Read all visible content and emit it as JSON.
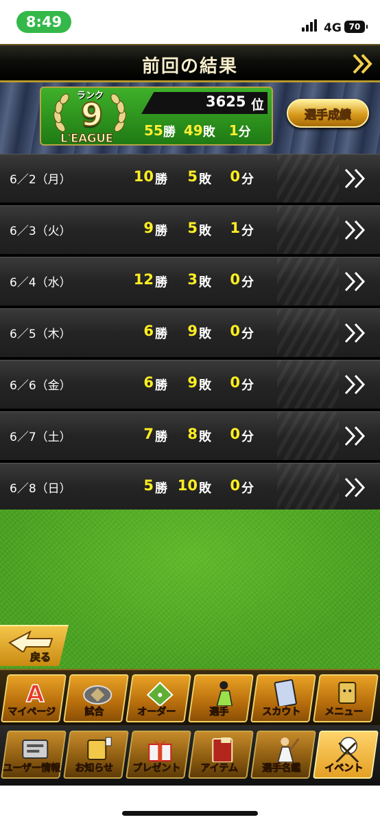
{
  "status_bar": {
    "time": "8:49",
    "network": "4G",
    "battery": "70"
  },
  "header": {
    "title": "前回の結果"
  },
  "summary": {
    "rank_word": "ランク",
    "rank_number": "9",
    "league_label": "L'EAGUE",
    "position": "3625",
    "position_unit": "位",
    "wins": "55",
    "wins_unit": "勝",
    "losses": "49",
    "losses_unit": "敗",
    "draws": "1",
    "draws_unit": "分",
    "stats_button": "選手成績"
  },
  "units": {
    "win": "勝",
    "loss": "敗",
    "draw": "分"
  },
  "rows": [
    {
      "date": "6／2（月）",
      "wins": "10",
      "losses": "5",
      "draws": "0"
    },
    {
      "date": "6／3（火）",
      "wins": "9",
      "losses": "5",
      "draws": "1"
    },
    {
      "date": "6／4（水）",
      "wins": "12",
      "losses": "3",
      "draws": "0"
    },
    {
      "date": "6／5（木）",
      "wins": "6",
      "losses": "9",
      "draws": "0"
    },
    {
      "date": "6／6（金）",
      "wins": "6",
      "losses": "9",
      "draws": "0"
    },
    {
      "date": "6／7（土）",
      "wins": "7",
      "losses": "8",
      "draws": "0"
    },
    {
      "date": "6／8（日）",
      "wins": "5",
      "losses": "10",
      "draws": "0"
    }
  ],
  "back_button": {
    "label": "戻る"
  },
  "nav_primary": [
    {
      "label": "マイページ",
      "icon": "a-logo-icon"
    },
    {
      "label": "試合",
      "icon": "stadium-icon"
    },
    {
      "label": "オーダー",
      "icon": "diamond-field-icon"
    },
    {
      "label": "選手",
      "icon": "pitcher-icon"
    },
    {
      "label": "スカウト",
      "icon": "card-icon"
    },
    {
      "label": "メニュー",
      "icon": "menu-robot-icon"
    }
  ],
  "nav_secondary": [
    {
      "label": "ユーザー情報",
      "icon": "user-info-icon"
    },
    {
      "label": "お知らせ",
      "icon": "notice-icon"
    },
    {
      "label": "プレゼント",
      "icon": "gift-icon"
    },
    {
      "label": "アイテム",
      "icon": "item-book-icon"
    },
    {
      "label": "選手名鑑",
      "icon": "batter-icon"
    },
    {
      "label": "イベント",
      "icon": "baseball-icon"
    }
  ],
  "colors": {
    "accent_yellow": "#ffee22",
    "gold": "#e9a226",
    "field_green": "#4aa321"
  }
}
